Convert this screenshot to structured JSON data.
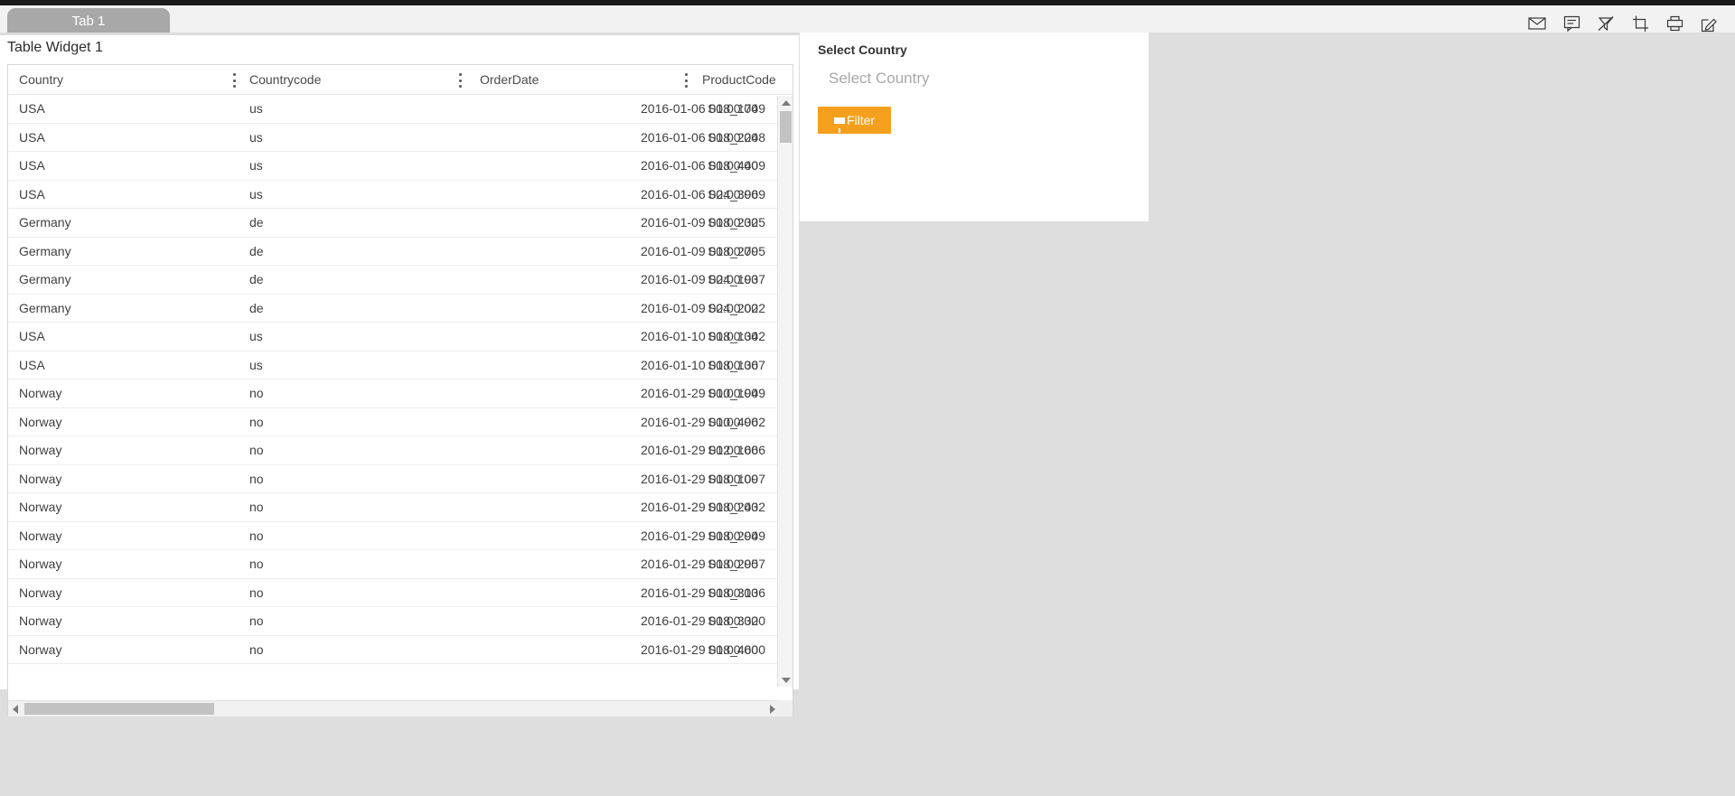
{
  "tabs": [
    {
      "label": "Tab 1",
      "active": true
    }
  ],
  "toolbar": {
    "icons": [
      {
        "name": "mail-icon",
        "title": "Mail"
      },
      {
        "name": "comment-icon",
        "title": "Comment"
      },
      {
        "name": "clear-filter-icon",
        "title": "Clear Filter"
      },
      {
        "name": "crop-icon",
        "title": "Crop"
      },
      {
        "name": "print-icon",
        "title": "Print"
      },
      {
        "name": "edit-icon",
        "title": "Edit"
      }
    ]
  },
  "widget": {
    "title": "Table Widget 1"
  },
  "table": {
    "columns": [
      {
        "key": "country",
        "label": "Country",
        "align": "left"
      },
      {
        "key": "countrycode",
        "label": "Countrycode",
        "align": "left"
      },
      {
        "key": "orderdate",
        "label": "OrderDate",
        "align": "right"
      },
      {
        "key": "productcode",
        "label": "ProductCode",
        "align": "right"
      }
    ],
    "rows": [
      {
        "country": "USA",
        "countrycode": "us",
        "orderdate": "2016-01-06 00:00:00",
        "productcode": "S18_1749"
      },
      {
        "country": "USA",
        "countrycode": "us",
        "orderdate": "2016-01-06 00:00:00",
        "productcode": "S18_2248"
      },
      {
        "country": "USA",
        "countrycode": "us",
        "orderdate": "2016-01-06 00:00:00",
        "productcode": "S18_4409"
      },
      {
        "country": "USA",
        "countrycode": "us",
        "orderdate": "2016-01-06 00:00:00",
        "productcode": "S24_3969"
      },
      {
        "country": "Germany",
        "countrycode": "de",
        "orderdate": "2016-01-09 00:00:00",
        "productcode": "S18_2325"
      },
      {
        "country": "Germany",
        "countrycode": "de",
        "orderdate": "2016-01-09 00:00:00",
        "productcode": "S18_2795"
      },
      {
        "country": "Germany",
        "countrycode": "de",
        "orderdate": "2016-01-09 00:00:00",
        "productcode": "S24_1937"
      },
      {
        "country": "Germany",
        "countrycode": "de",
        "orderdate": "2016-01-09 00:00:00",
        "productcode": "S24_2022"
      },
      {
        "country": "USA",
        "countrycode": "us",
        "orderdate": "2016-01-10 00:00:00",
        "productcode": "S18_1342"
      },
      {
        "country": "USA",
        "countrycode": "us",
        "orderdate": "2016-01-10 00:00:00",
        "productcode": "S18_1367"
      },
      {
        "country": "Norway",
        "countrycode": "no",
        "orderdate": "2016-01-29 00:00:00",
        "productcode": "S10_1949"
      },
      {
        "country": "Norway",
        "countrycode": "no",
        "orderdate": "2016-01-29 00:00:00",
        "productcode": "S10_4962"
      },
      {
        "country": "Norway",
        "countrycode": "no",
        "orderdate": "2016-01-29 00:00:00",
        "productcode": "S12_1666"
      },
      {
        "country": "Norway",
        "countrycode": "no",
        "orderdate": "2016-01-29 00:00:00",
        "productcode": "S18_1097"
      },
      {
        "country": "Norway",
        "countrycode": "no",
        "orderdate": "2016-01-29 00:00:00",
        "productcode": "S18_2432"
      },
      {
        "country": "Norway",
        "countrycode": "no",
        "orderdate": "2016-01-29 00:00:00",
        "productcode": "S18_2949"
      },
      {
        "country": "Norway",
        "countrycode": "no",
        "orderdate": "2016-01-29 00:00:00",
        "productcode": "S18_2957"
      },
      {
        "country": "Norway",
        "countrycode": "no",
        "orderdate": "2016-01-29 00:00:00",
        "productcode": "S18_3136"
      },
      {
        "country": "Norway",
        "countrycode": "no",
        "orderdate": "2016-01-29 00:00:00",
        "productcode": "S18_3320"
      },
      {
        "country": "Norway",
        "countrycode": "no",
        "orderdate": "2016-01-29 00:00:00",
        "productcode": "S18_4600"
      }
    ]
  },
  "filter_panel": {
    "label": "Select Country",
    "select_placeholder": "Select Country",
    "select_value": "",
    "button_label": "Filter"
  },
  "colors": {
    "accent_orange": "#f5a01d",
    "page_background": "#dedede",
    "tab_active": "#a8a8a8",
    "panel_background": "#ffffff",
    "scrollbar_thumb": "#c2c2c2"
  }
}
